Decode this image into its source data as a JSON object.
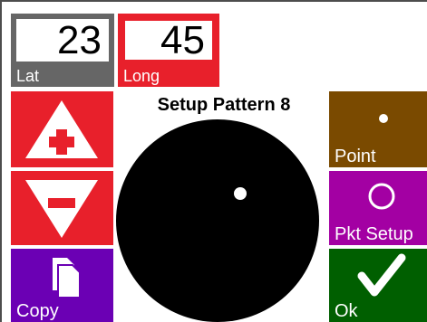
{
  "lat": {
    "value": "23",
    "label": "Lat"
  },
  "long": {
    "value": "45",
    "label": "Long"
  },
  "title": "Setup Pattern 8",
  "buttons": {
    "increase_icon": "plus-triangle-icon",
    "decrease_icon": "minus-triangle-icon",
    "copy_label": "Copy",
    "point_label": "Point",
    "pkt_setup_label": "Pkt Setup",
    "ok_label": "Ok"
  },
  "colors": {
    "red": "#e8202b",
    "gray": "#666666",
    "purple": "#6b00b4",
    "brown": "#7a4a00",
    "magenta": "#a300a3",
    "green": "#005f00",
    "pattern_fill": "#000000"
  }
}
